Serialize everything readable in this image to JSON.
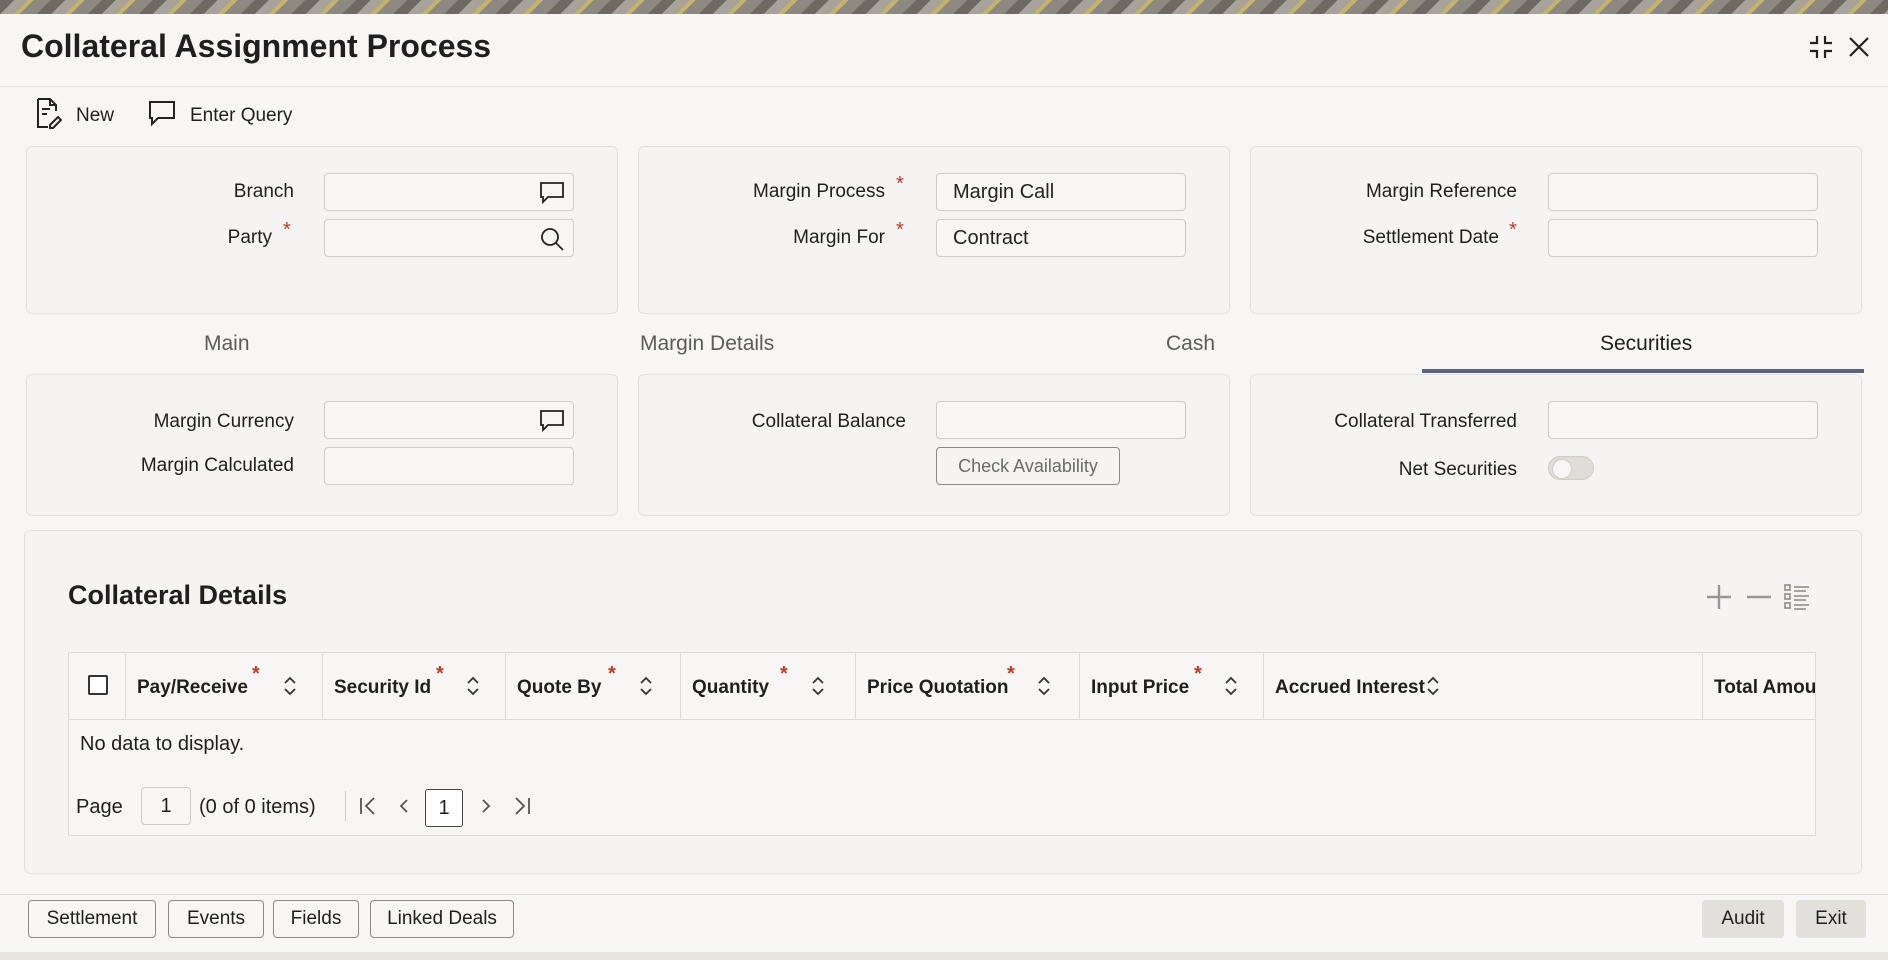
{
  "window": {
    "title": "Collateral Assignment Process"
  },
  "toolbar": {
    "new_label": "New",
    "enter_query_label": "Enter Query"
  },
  "header": {
    "branch_label": "Branch",
    "branch_value": "",
    "party_label": "Party",
    "party_value": "",
    "margin_process_label": "Margin Process",
    "margin_process_value": "Margin Call",
    "margin_for_label": "Margin For",
    "margin_for_value": "Contract",
    "margin_reference_label": "Margin Reference",
    "margin_reference_value": "",
    "settlement_date_label": "Settlement Date",
    "settlement_date_value": "",
    "required_mark": "*"
  },
  "tabs": [
    {
      "label": "Main"
    },
    {
      "label": "Margin Details"
    },
    {
      "label": "Cash"
    },
    {
      "label": "Securities"
    }
  ],
  "active_tab": "Securities",
  "securities": {
    "margin_currency_label": "Margin Currency",
    "margin_currency_value": "",
    "margin_calculated_label": "Margin Calculated",
    "margin_calculated_value": "",
    "collateral_balance_label": "Collateral Balance",
    "collateral_balance_value": "",
    "check_availability_label": "Check Availability",
    "collateral_transferred_label": "Collateral Transferred",
    "collateral_transferred_value": "",
    "net_securities_label": "Net Securities",
    "net_securities_on": false
  },
  "collateral_details": {
    "title": "Collateral Details",
    "columns": [
      {
        "label": "Pay/Receive",
        "required": true
      },
      {
        "label": "Security Id",
        "required": true
      },
      {
        "label": "Quote By",
        "required": true
      },
      {
        "label": "Quantity",
        "required": true
      },
      {
        "label": "Price Quotation",
        "required": true
      },
      {
        "label": "Input Price",
        "required": true
      },
      {
        "label": "Accrued Interest",
        "required": false
      },
      {
        "label": "Total Amour",
        "required": false
      }
    ],
    "rows": [],
    "empty_text": "No data to display.",
    "pager": {
      "page_label": "Page",
      "page_value": "1",
      "items_text": "(0 of 0 items)",
      "current_page": "1"
    }
  },
  "footer": {
    "buttons": [
      "Settlement",
      "Events",
      "Fields",
      "Linked Deals"
    ],
    "audit_label": "Audit",
    "exit_label": "Exit"
  },
  "icons": {
    "new": "new-document-icon",
    "enter_query": "query-bubble-icon",
    "branch_lov": "chat-bubble-icon",
    "party_lov": "search-icon",
    "currency_lov": "chat-bubble-icon",
    "minimize": "minimize-icon",
    "close": "close-icon"
  },
  "colors": {
    "required": "#c0392b",
    "tab_underline": "#5a6478"
  }
}
